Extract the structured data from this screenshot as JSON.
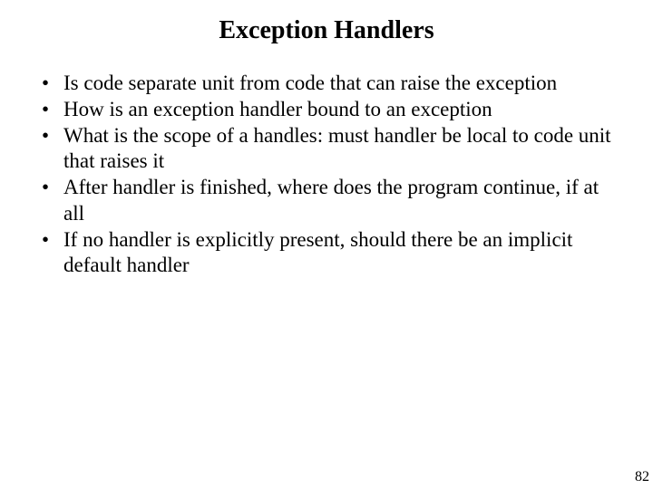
{
  "title": "Exception Handlers",
  "bullets": [
    "Is code separate unit from code that can raise the exception",
    "How is an exception handler bound to an exception",
    "What is the scope of a handles: must handler be local to code unit that raises it",
    "After handler is finished, where does the program continue, if at all",
    "If no handler is explicitly present, should there be an implicit default handler"
  ],
  "page_number": "82"
}
